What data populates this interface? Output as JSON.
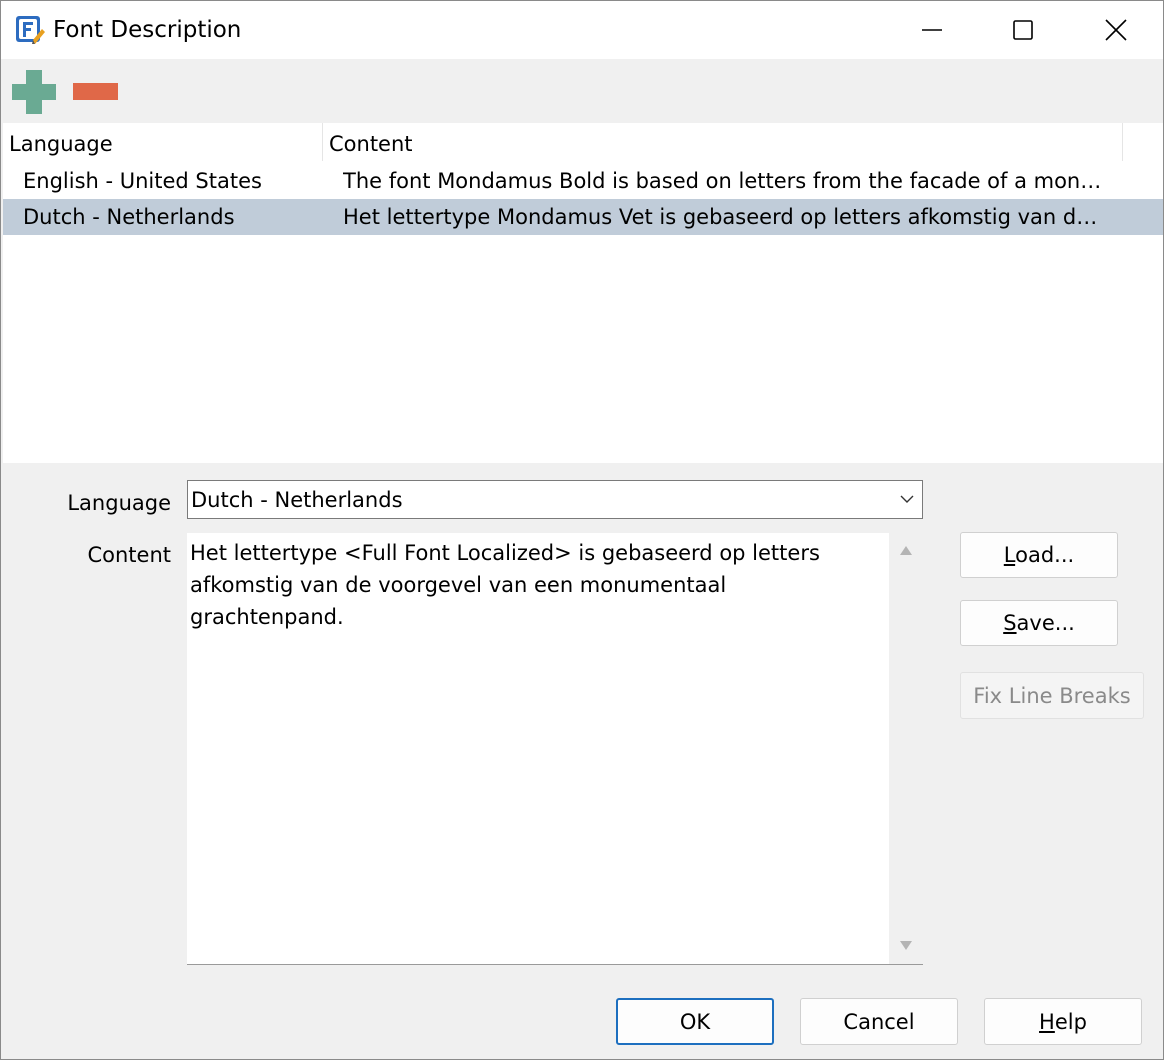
{
  "window": {
    "title": "Font Description",
    "icon": "fontcreator-app-icon",
    "controls": [
      "minimize-icon",
      "maximize-icon",
      "close-icon"
    ]
  },
  "toolbar": {
    "add_icon": "plus-icon",
    "remove_icon": "minus-icon",
    "colors": {
      "add": "#6aaa93",
      "remove": "#e06848"
    }
  },
  "listview": {
    "columns": [
      "Language",
      "Content"
    ],
    "rows": [
      {
        "language": "English - United States",
        "content": "The font Mondamus Bold is based on letters from the facade of a mon…",
        "selected": false
      },
      {
        "language": "Dutch - Netherlands",
        "content": "Het lettertype Mondamus Vet is gebaseerd op letters afkomstig van d…",
        "selected": true
      }
    ],
    "selection_color": "#c0ccd9"
  },
  "form": {
    "language_label": "Language",
    "language_value": "Dutch - Netherlands",
    "content_label": "Content",
    "content_value": "Het lettertype <Full Font Localized> is gebaseerd op letters\nafkomstig van de voorgevel van een monumentaal\ngrachtenpand."
  },
  "buttons": {
    "load": {
      "pre": "",
      "key": "L",
      "post": "oad..."
    },
    "save": {
      "pre": "",
      "key": "S",
      "post": "ave..."
    },
    "fix_line_breaks": "Fix Line Breaks",
    "ok": "OK",
    "cancel": "Cancel",
    "help": {
      "pre": "",
      "key": "H",
      "post": "elp"
    }
  }
}
